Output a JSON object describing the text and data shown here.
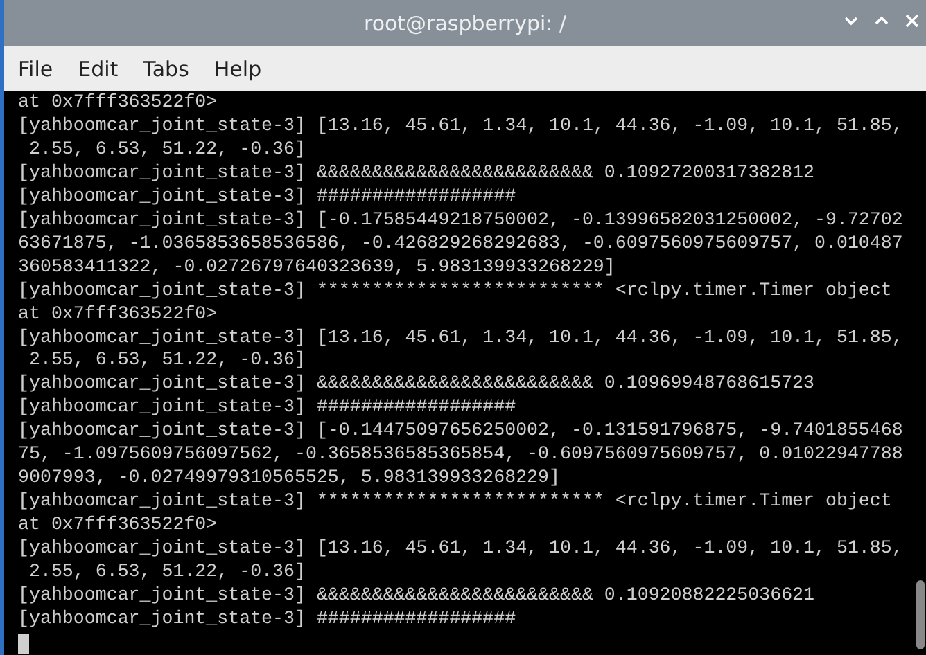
{
  "window": {
    "title": "root@raspberrypi: /"
  },
  "menu": [
    "File",
    "Edit",
    "Tabs",
    "Help"
  ],
  "terminal": {
    "lines": [
      "at 0x7fff363522f0>",
      "[yahboomcar_joint_state-3] [13.16, 45.61, 1.34, 10.1, 44.36, -1.09, 10.1, 51.85,",
      " 2.55, 6.53, 51.22, -0.36]",
      "[yahboomcar_joint_state-3] &&&&&&&&&&&&&&&&&&&&&&&&& 0.10927200317382812",
      "[yahboomcar_joint_state-3] ##################",
      "[yahboomcar_joint_state-3] [-0.17585449218750002, -0.13996582031250002, -9.72702",
      "63671875, -1.0365853658536586, -0.426829268292683, -0.6097560975609757, 0.010487",
      "360583411322, -0.02726797640323639, 5.983139933268229]",
      "[yahboomcar_joint_state-3] ************************** <rclpy.timer.Timer object",
      "at 0x7fff363522f0>",
      "[yahboomcar_joint_state-3] [13.16, 45.61, 1.34, 10.1, 44.36, -1.09, 10.1, 51.85,",
      " 2.55, 6.53, 51.22, -0.36]",
      "[yahboomcar_joint_state-3] &&&&&&&&&&&&&&&&&&&&&&&&& 0.10969948768615723",
      "[yahboomcar_joint_state-3] ##################",
      "[yahboomcar_joint_state-3] [-0.14475097656250002, -0.131591796875, -9.7401855468",
      "75, -1.0975609756097562, -0.3658536585365854, -0.6097560975609757, 0.01022947788",
      "9007993, -0.02749979310565525, 5.983139933268229]",
      "[yahboomcar_joint_state-3] ************************** <rclpy.timer.Timer object",
      "at 0x7fff363522f0>",
      "[yahboomcar_joint_state-3] [13.16, 45.61, 1.34, 10.1, 44.36, -1.09, 10.1, 51.85,",
      " 2.55, 6.53, 51.22, -0.36]",
      "[yahboomcar_joint_state-3] &&&&&&&&&&&&&&&&&&&&&&&&& 0.10920882225036621",
      "[yahboomcar_joint_state-3] ##################"
    ]
  }
}
